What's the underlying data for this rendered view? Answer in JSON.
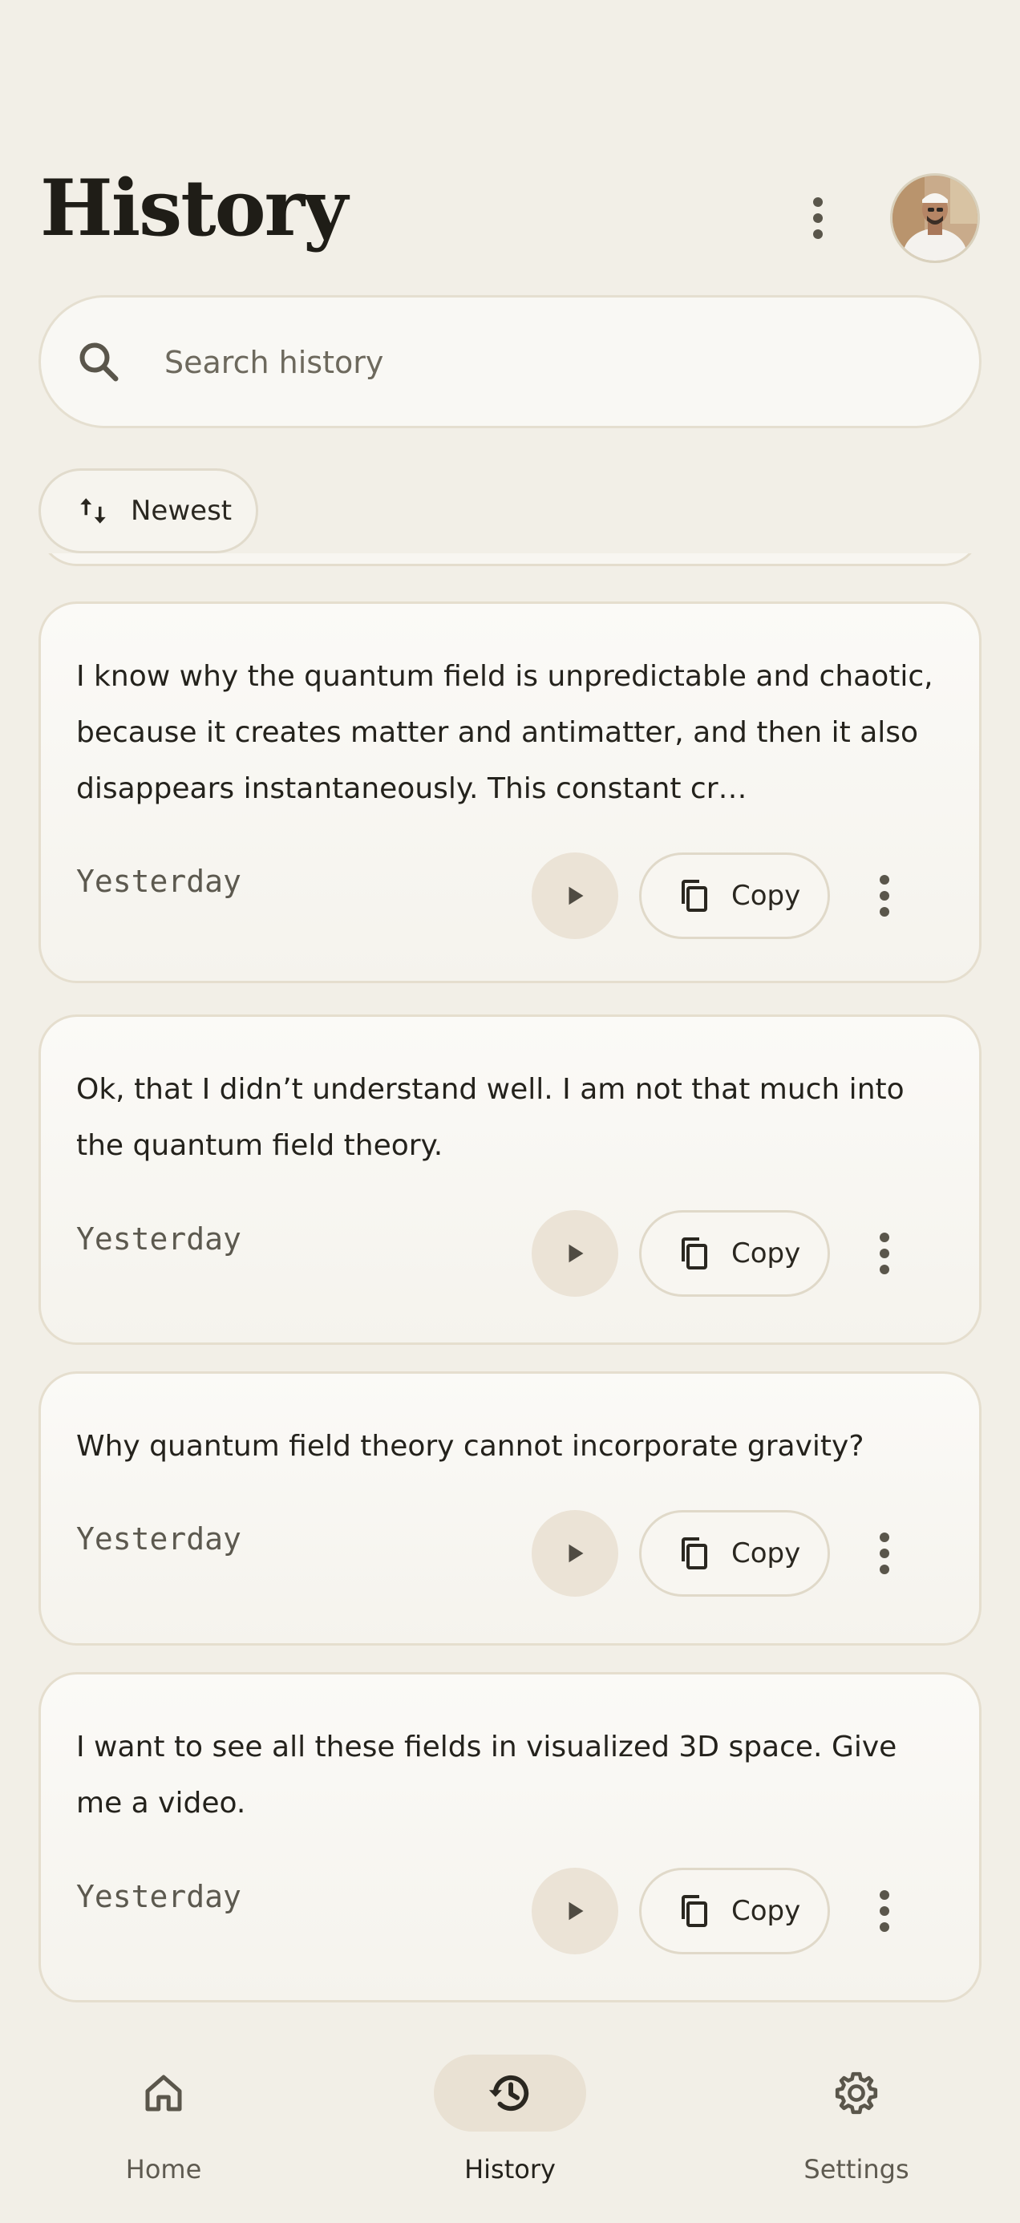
{
  "header": {
    "title": "History",
    "more_icon": "more-vert-icon",
    "avatar_alt": "profile-avatar"
  },
  "search": {
    "placeholder": "Search history",
    "value": ""
  },
  "sort": {
    "label": "Newest",
    "icon": "swap-vert-icon"
  },
  "items": [
    {
      "text": "I know why the quantum field is unpredictable and chaotic, because it creates matter and antimatter, and then it also disappears instantaneously. This constant cr…",
      "time": "Yesterday",
      "copy_label": "Copy"
    },
    {
      "text": "Ok, that I didn’t understand well. I am not that much into the quantum field theory.",
      "time": "Yesterday",
      "copy_label": "Copy"
    },
    {
      "text": "Why quantum field theory cannot incorporate gravity?",
      "time": "Yesterday",
      "copy_label": "Copy"
    },
    {
      "text": "I want to see all these fields in visualized 3D space. Give me a video.",
      "time": "Yesterday",
      "copy_label": "Copy"
    }
  ],
  "nav": {
    "home": "Home",
    "history": "History",
    "settings": "Settings",
    "active": "history"
  },
  "colors": {
    "background": "#f2efe7",
    "card": "#f9f8f4",
    "accent_pill": "#e9e1d3",
    "text": "#24221c",
    "muted": "#5e5a50"
  }
}
